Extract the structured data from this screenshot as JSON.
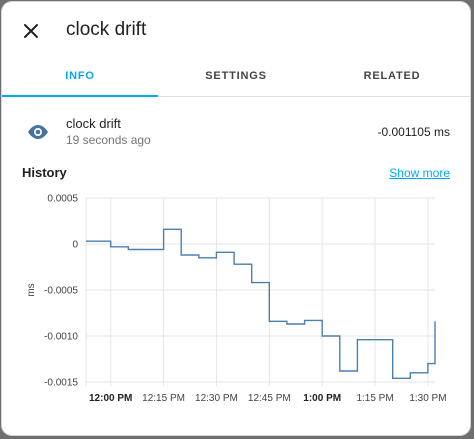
{
  "dialog": {
    "title": "clock drift",
    "close_icon": "close-icon"
  },
  "tabs": [
    {
      "label": "INFO",
      "active": true
    },
    {
      "label": "SETTINGS",
      "active": false
    },
    {
      "label": "RELATED",
      "active": false
    }
  ],
  "entity": {
    "icon": "eye-icon",
    "name": "clock drift",
    "last_changed": "19 seconds ago",
    "state": "-0.001105 ms"
  },
  "history": {
    "title": "History",
    "show_more": "Show more"
  },
  "colors": {
    "accent": "#03a9f4",
    "line": "#4a7fb0",
    "icon": "#44739e"
  },
  "chart_data": {
    "type": "line",
    "step": true,
    "ylabel": "ms",
    "ylim": [
      -0.0015,
      0.0005
    ],
    "yticks": [
      "0.0005",
      "0",
      "-0.0005",
      "-0.0010",
      "-0.0015"
    ],
    "ytick_values": [
      0.0005,
      0,
      -0.0005,
      -0.001,
      -0.0015
    ],
    "xticks": [
      "12:00 PM",
      "12:15 PM",
      "12:30 PM",
      "12:45 PM",
      "1:00 PM",
      "1:15 PM",
      "1:30 PM"
    ],
    "xtick_bold": [
      true,
      false,
      false,
      false,
      true,
      false,
      false
    ],
    "x_minutes_range": [
      -7,
      92
    ],
    "xtick_minutes": [
      0,
      15,
      30,
      45,
      60,
      75,
      90
    ],
    "series": [
      {
        "x_minutes": [
          -7,
          0,
          5,
          15,
          20,
          25,
          30,
          35,
          40,
          45,
          50,
          55,
          60,
          65,
          70,
          75,
          80,
          85,
          90,
          92
        ],
        "y": [
          3e-05,
          -3e-05,
          -6e-05,
          0.00016,
          -0.00012,
          -0.00015,
          -9e-05,
          -0.00022,
          -0.00042,
          -0.00084,
          -0.00087,
          -0.00083,
          -0.001,
          -0.00138,
          -0.00104,
          -0.00104,
          -0.00146,
          -0.0014,
          -0.0013,
          -0.00084
        ],
        "end_y": -0.0011
      }
    ],
    "grid": true
  }
}
